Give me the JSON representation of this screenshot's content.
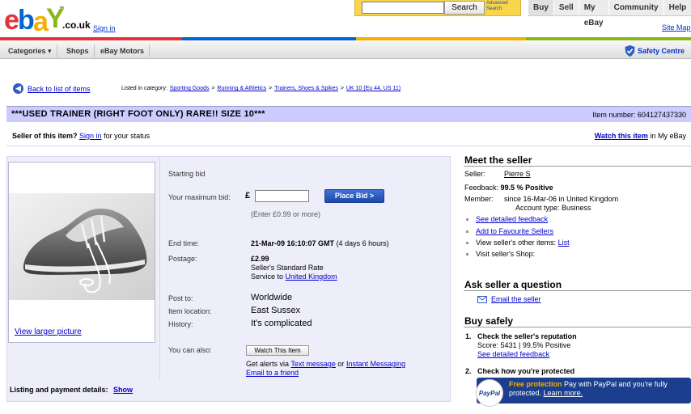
{
  "header": {
    "logo_text": "ebay",
    "logo_suffix": ".co.uk",
    "logo_tm": "™",
    "sign_in": "Sign in",
    "search_button": "Search",
    "advanced_search": "Advanced Search",
    "nav": [
      "Buy",
      "Sell",
      "My eBay",
      "Community",
      "Help"
    ],
    "site_map": "Site Map",
    "brand_colors": [
      "#e53238",
      "#0064d2",
      "#f5af02",
      "#86b817"
    ]
  },
  "category_bar": {
    "categories": "Categories ▾",
    "shops": "Shops",
    "motors": "eBay Motors",
    "safety_centre": "Safety Centre"
  },
  "breadcrumb": {
    "back": "Back to list of items",
    "listed_in": "Listed in category:",
    "path": [
      "Sporting Goods",
      "Running & Athletics",
      "Trainers, Shoes & Spikes",
      "UK 10 (Eu 44, US 11)"
    ],
    "separator": ">"
  },
  "item": {
    "title": "***USED TRAINER (RIGHT FOOT ONLY) RARE!! SIZE 10***",
    "item_number": "Item number: 604127437330",
    "seller_prompt": "Seller of this item?",
    "seller_signin": "Sign in",
    "seller_status": "for your status",
    "watch_link": "Watch this item",
    "watch_suffix": "in My eBay",
    "view_larger": "View larger picture"
  },
  "bid": {
    "starting_bid_label": "Starting bid",
    "max_bid_label": "Your maximum bid:",
    "currency": "£",
    "bid_value": "",
    "place_bid": "Place Bid >",
    "hint": "(Enter £0.99 or more)",
    "end_time_label": "End time:",
    "end_time": "21-Mar-09 16:10:07 GMT",
    "end_time_rel": "(4 days 6 hours)",
    "postage_label": "Postage:",
    "postage_price": "£2.99",
    "postage_rate": "Seller's Standard Rate",
    "service_to": "Service to",
    "service_country": "United Kingdom",
    "post_to_label": "Post to:",
    "post_to": "Worldwide",
    "location_label": "Item location:",
    "location": "East Sussex",
    "history_label": "History:",
    "history": "It's complicated",
    "you_can_also": "You can also:",
    "watch_button": "Watch This Item",
    "alerts_prefix": "Get alerts via",
    "text_message": "Text message",
    "or": "or",
    "instant_messaging": "Instant Messaging",
    "email_friend": "Email to a friend"
  },
  "listing_details": {
    "label": "Listing and payment details:",
    "show": "Show"
  },
  "seller_panel": {
    "heading": "Meet the seller",
    "seller_label": "Seller:",
    "seller_name": "Pierre S",
    "feedback_label": "Feedback:",
    "feedback_value": "99.5 % Positive",
    "member_label": "Member:",
    "member_since": "since 16-Mar-06 in United Kingdom",
    "account_type": "Account type: Business",
    "links": [
      "See detailed feedback",
      "Add to Favourite Sellers"
    ],
    "other_items_prefix": "View seller's other items:",
    "other_items_link": "List",
    "shop": "Visit seller's Shop:"
  },
  "ask": {
    "heading": "Ask seller a question",
    "email": "Email the seller"
  },
  "buy_safely": {
    "heading": "Buy safely",
    "step1_num": "1.",
    "step1": "Check the seller's reputation",
    "score": "Score: 5431 | 99.5% Positive",
    "feedback_link": "See detailed feedback",
    "step2_num": "2.",
    "step2": "Check how you're protected",
    "paypal_logo": "PayPal",
    "paypal_highlight": "Free protection",
    "paypal_text": "Pay with PayPal and you're fully protected.",
    "learn_more": "Learn more."
  }
}
